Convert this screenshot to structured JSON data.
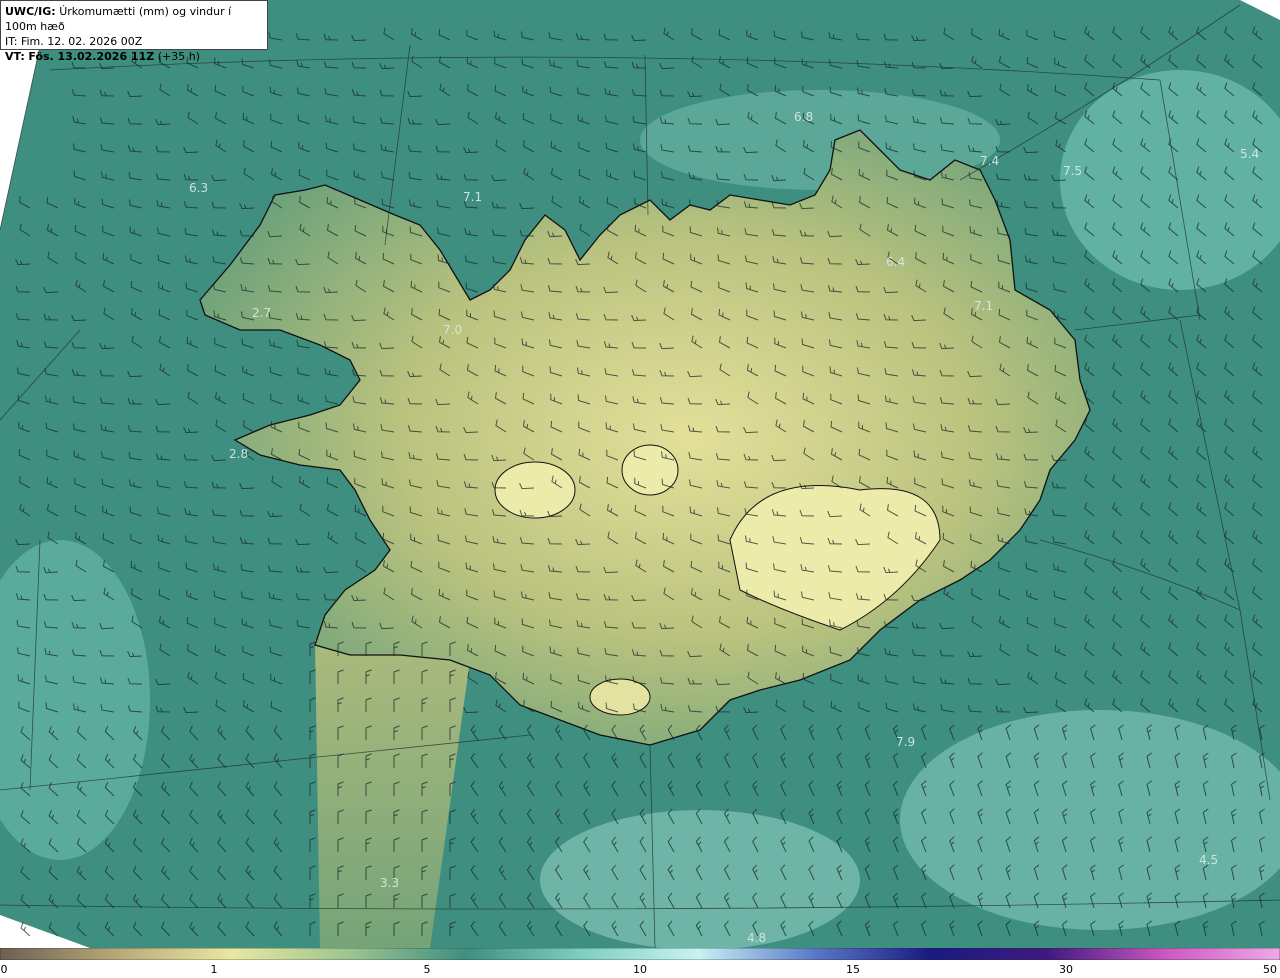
{
  "header": {
    "title_prefix": "UWC/IG:",
    "title_text": "Úrkomumætti (mm) og vindur í 100m hæð",
    "init_line": "IT: Fim. 12. 02. 2026 00Z",
    "valid_prefix": "VT:",
    "valid_time": "Fös. 13.02.2026 11Z",
    "valid_offset": "(+35 h)"
  },
  "contour_labels": [
    "6.8",
    "7.4",
    "7.5",
    "5.4",
    "6.3",
    "7.1",
    "6.4",
    "2.7",
    "7.0",
    "7.1",
    "2.8",
    "7.9",
    "3.3",
    "4.8",
    "4.5"
  ],
  "colorbar": {
    "ticks": [
      "0",
      "1",
      "5",
      "10",
      "15",
      "30",
      "50"
    ],
    "colors": [
      "#6b5f52",
      "#b8a878",
      "#e9e7a0",
      "#9cc590",
      "#3f8f80",
      "#7fcfc0",
      "#c8f2f2",
      "#5a78c8",
      "#1a1a80",
      "#401a80",
      "#c858c0",
      "#f0a8e8"
    ]
  },
  "map": {
    "background_color": "#3f8f80",
    "land_color": "#c8c884",
    "coast_color": "#111111",
    "barb_color": "#1a2a2a"
  }
}
